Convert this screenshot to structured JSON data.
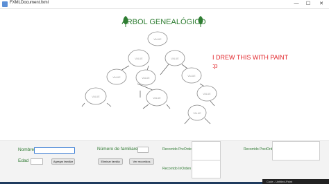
{
  "window": {
    "title": "FXMLDocument.fxml",
    "minimize_glyph": "—",
    "maximize_glyph": "☐",
    "close_glyph": "✕"
  },
  "tree": {
    "title": "ÁRBOL GENEALÓGICO",
    "node_label": "VALUE",
    "leaf_color": "#2e7d32"
  },
  "note": {
    "line1": "I DREW THIS WITH PAINT",
    "line2": ":p"
  },
  "form": {
    "nombre_label": "Nombre",
    "edad_label": "Edad",
    "agregar_button": "Agregar familiar",
    "numero_label": "Número de familiares",
    "eliminar_button": "Eliminar familia",
    "ver_button": "Ver recorridos",
    "preorden_label": "Recorrido PreOrden",
    "inorden_label": "Recorrido InOrden",
    "postorden_label": "Recorrido PostOrden"
  },
  "taskbar": {
    "right_text": "Code - Untitled-Paint"
  }
}
